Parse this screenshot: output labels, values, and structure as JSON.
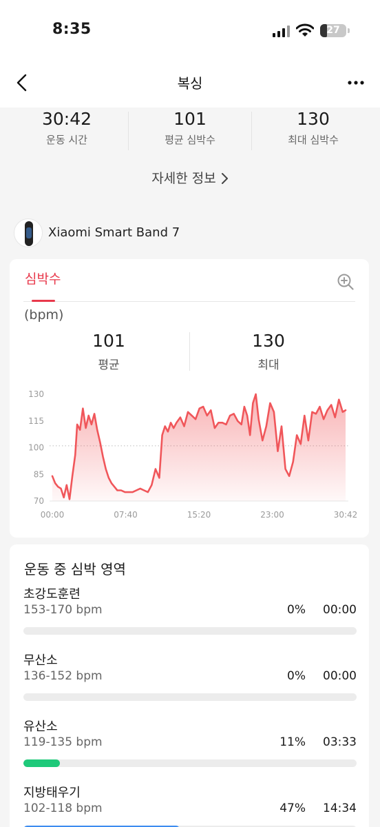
{
  "status_bar": {
    "time": "8:35",
    "battery": "27",
    "battery_level": 0.27
  },
  "nav": {
    "title": "복싱"
  },
  "summary": [
    {
      "value": "30:42",
      "label": "운동 시간"
    },
    {
      "value": "101",
      "label": "평균 심박수"
    },
    {
      "value": "130",
      "label": "최대 심박수"
    }
  ],
  "details_link": "자세한 정보",
  "device": {
    "name": "Xiaomi Smart Band 7"
  },
  "heart_rate": {
    "tab": "심박수",
    "unit": "(bpm)",
    "avg_value": "101",
    "avg_label": "평균",
    "max_value": "130",
    "max_label": "최대"
  },
  "chart_data": {
    "type": "area",
    "x_ticks": [
      "00:00",
      "07:40",
      "15:20",
      "23:00",
      "30:42"
    ],
    "y_ticks": [
      130,
      115,
      100,
      85,
      70
    ],
    "ylim": [
      70,
      130
    ],
    "xlim_minutes": [
      0,
      30.7
    ],
    "average_line": 101,
    "color": "#f0565a",
    "x_minutes": [
      0,
      0.3,
      0.6,
      0.9,
      1.2,
      1.5,
      1.8,
      2.1,
      2.4,
      2.6,
      2.9,
      3.2,
      3.5,
      3.8,
      4.1,
      4.4,
      4.7,
      5.0,
      5.3,
      5.6,
      5.9,
      6.2,
      6.5,
      6.8,
      7.2,
      7.6,
      8.0,
      8.4,
      8.8,
      9.2,
      9.6,
      10.0,
      10.4,
      10.8,
      11.2,
      11.5,
      11.8,
      12.1,
      12.4,
      12.7,
      13.0,
      13.4,
      13.8,
      14.2,
      14.6,
      15.0,
      15.4,
      15.8,
      16.2,
      16.6,
      17.0,
      17.4,
      17.8,
      18.2,
      18.6,
      19.0,
      19.4,
      19.8,
      20.1,
      20.4,
      20.7,
      21.0,
      21.3,
      21.6,
      22.0,
      22.4,
      22.8,
      23.2,
      23.6,
      24.0,
      24.4,
      24.8,
      25.2,
      25.6,
      26.0,
      26.4,
      26.8,
      27.2,
      27.6,
      28.0,
      28.4,
      28.8,
      29.2,
      29.6,
      30.0,
      30.4,
      30.7
    ],
    "values": [
      84,
      80,
      78,
      77,
      72,
      79,
      71,
      84,
      96,
      113,
      110,
      122,
      111,
      118,
      113,
      119,
      110,
      103,
      95,
      88,
      83,
      80,
      78,
      76,
      76,
      75,
      75,
      75,
      76,
      77,
      76,
      75,
      79,
      88,
      83,
      107,
      112,
      109,
      114,
      111,
      114,
      117,
      112,
      120,
      118,
      116,
      122,
      123,
      118,
      121,
      111,
      114,
      114,
      113,
      118,
      119,
      115,
      113,
      123,
      118,
      107,
      125,
      130,
      116,
      104,
      112,
      125,
      120,
      98,
      112,
      88,
      84,
      92,
      107,
      102,
      118,
      104,
      120,
      119,
      123,
      116,
      121,
      124,
      117,
      127,
      120,
      121
    ]
  },
  "zones": {
    "title": "운동 중 심박 영역",
    "items": [
      {
        "name": "초강도훈련",
        "range": "153-170 bpm",
        "percent": "0%",
        "duration": "00:00",
        "fraction": 0.0,
        "color": "#e8384b"
      },
      {
        "name": "무산소",
        "range": "136-152 bpm",
        "percent": "0%",
        "duration": "00:00",
        "fraction": 0.0,
        "color": "#f5a623"
      },
      {
        "name": "유산소",
        "range": "119-135 bpm",
        "percent": "11%",
        "duration": "03:33",
        "fraction": 0.11,
        "color": "#1fc97a"
      },
      {
        "name": "지방태우기",
        "range": "102-118 bpm",
        "percent": "47%",
        "duration": "14:34",
        "fraction": 0.47,
        "color": "#3d8cf0"
      }
    ]
  }
}
